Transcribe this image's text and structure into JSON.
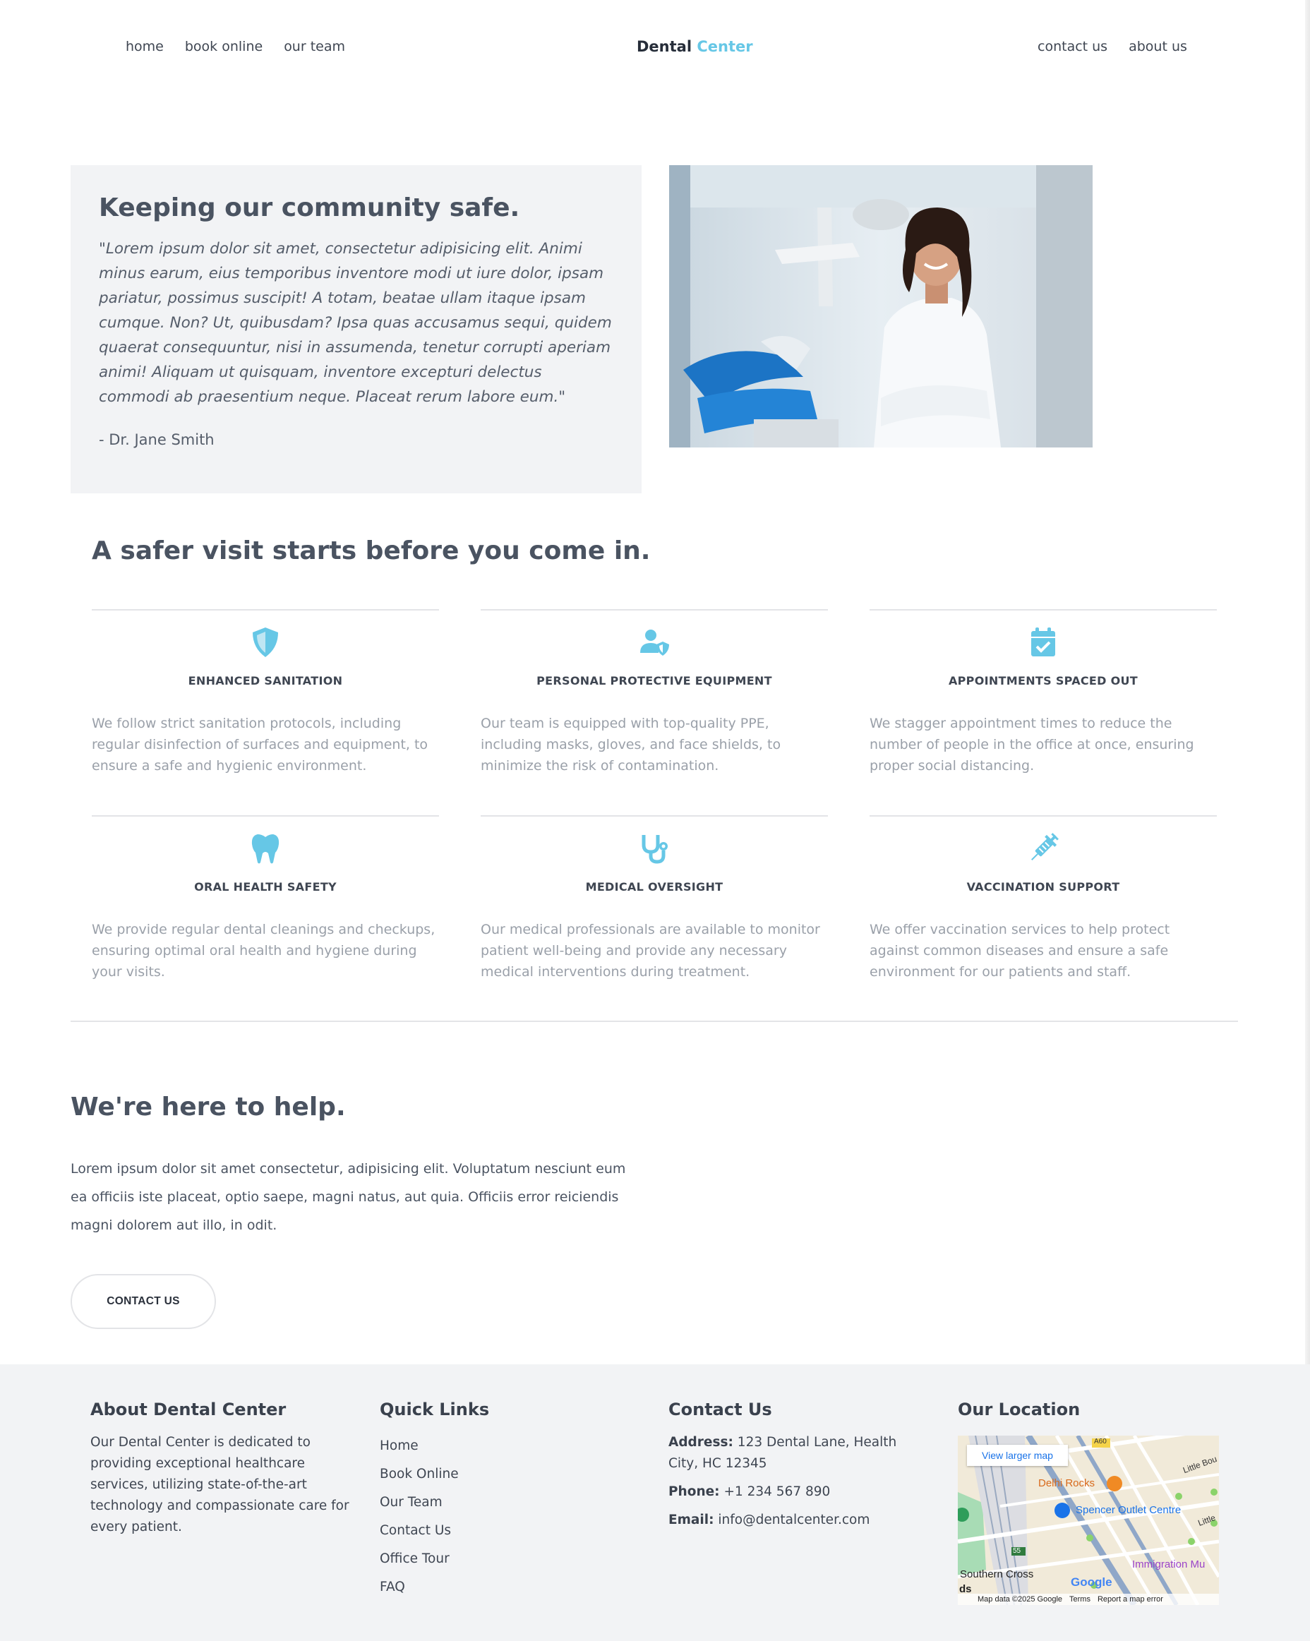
{
  "header": {
    "nav_left": [
      "home",
      "book online",
      "our team"
    ],
    "nav_right": [
      "contact us",
      "about us"
    ],
    "brand_main": "Dental",
    "brand_accent": "Center"
  },
  "hero": {
    "title": "Keeping our community safe.",
    "quote": "\"Lorem ipsum dolor sit amet, consectetur adipisicing elit. Animi minus earum, eius temporibus inventore modi ut iure dolor, ipsam pariatur, possimus suscipit! A totam, beatae ullam itaque ipsam cumque. Non? Ut, quibusdam? Ipsa quas accusamus sequi, quidem quaerat consequuntur, nisi in assumenda, tenetur corrupti aperiam animi! Aliquam ut quisquam, inventore excepturi delectus commodi ab praesentium neque. Placeat rerum labore eum.\"",
    "author": "- Dr. Jane Smith"
  },
  "safety": {
    "title": "A safer visit starts before you come in.",
    "features": [
      {
        "icon": "shield-icon",
        "title": "ENHANCED SANITATION",
        "text": "We follow strict sanitation protocols, including regular disinfection of surfaces and equipment, to ensure a safe and hygienic environment."
      },
      {
        "icon": "user-shield-icon",
        "title": "PERSONAL PROTECTIVE EQUIPMENT",
        "text": "Our team is equipped with top-quality PPE, including masks, gloves, and face shields, to minimize the risk of contamination."
      },
      {
        "icon": "calendar-check-icon",
        "title": "APPOINTMENTS SPACED OUT",
        "text": "We stagger appointment times to reduce the number of people in the office at once, ensuring proper social distancing."
      },
      {
        "icon": "tooth-icon",
        "title": "ORAL HEALTH SAFETY",
        "text": "We provide regular dental cleanings and checkups, ensuring optimal oral health and hygiene during your visits."
      },
      {
        "icon": "stethoscope-icon",
        "title": "MEDICAL OVERSIGHT",
        "text": "Our medical professionals are available to monitor patient well-being and provide any necessary medical interventions during treatment."
      },
      {
        "icon": "syringe-icon",
        "title": "VACCINATION SUPPORT",
        "text": "We offer vaccination services to help protect against common diseases and ensure a safe environment for our patients and staff."
      }
    ]
  },
  "help": {
    "title": "We're here to help.",
    "text": "Lorem ipsum dolor sit amet consectetur, adipisicing elit. Voluptatum nesciunt eum ea officiis iste placeat, optio saepe, magni natus, aut quia. Officiis error reiciendis magni dolorem aut illo, in odit.",
    "button": "CONTACT US"
  },
  "footer": {
    "about_title": "About Dental Center",
    "about_text": "Our Dental Center is dedicated to providing exceptional healthcare services, utilizing state-of-the-art technology and compassionate care for every patient.",
    "links_title": "Quick Links",
    "links": [
      "Home",
      "Book Online",
      "Our Team",
      "Contact Us",
      "Office Tour",
      "FAQ"
    ],
    "contact_title": "Contact Us",
    "address_label": "Address:",
    "address": "123 Dental Lane, Health City, HC 12345",
    "phone_label": "Phone:",
    "phone": "+1 234 567 890",
    "email_label": "Email:",
    "email": "info@dentalcenter.com",
    "location_title": "Our Location"
  },
  "map": {
    "view_larger": "View larger map",
    "labels": [
      "Delhi Rocks",
      "Spencer Outlet Centre",
      "Immigration Mu",
      "Southern Cross",
      "Little Bou",
      "Little",
      "ds",
      "A60",
      "55"
    ],
    "footer": [
      "Map data ©2025 Google",
      "Terms",
      "Report a map error"
    ],
    "google": "Google"
  },
  "colors": {
    "accent": "#66c7e6",
    "heading": "#4a5361",
    "muted_text": "#9aa0a9",
    "footer_bg": "#f2f3f5"
  }
}
